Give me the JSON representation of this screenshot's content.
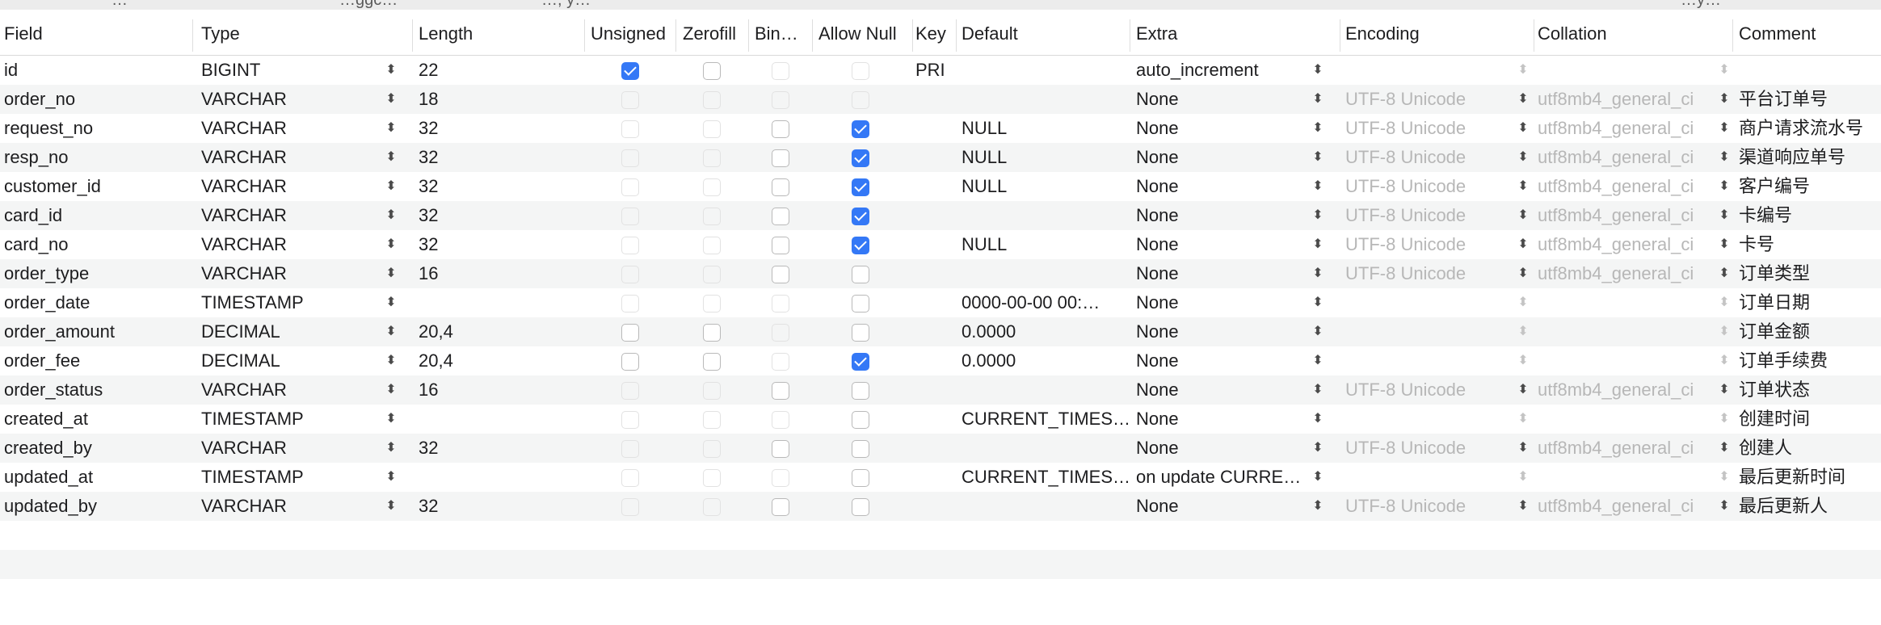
{
  "window_fragment": [
    "…",
    "…ggc…",
    "…, y…",
    "…y…"
  ],
  "columns": {
    "field": "Field",
    "type": "Type",
    "length": "Length",
    "unsigned": "Unsigned",
    "zerofill": "Zerofill",
    "binary": "Bin…",
    "allow_null": "Allow Null",
    "key": "Key",
    "default": "Default",
    "extra": "Extra",
    "encoding": "Encoding",
    "collation": "Collation",
    "comment": "Comment"
  },
  "rows": [
    {
      "field": "id",
      "type": "BIGINT",
      "length": "22",
      "unsigned": true,
      "zerofill": false,
      "binary": false,
      "allow_null": false,
      "key": "PRI",
      "default": "",
      "extra": "auto_increment",
      "encoding": "",
      "collation": "",
      "comment": "",
      "enabled": {
        "unsigned": true,
        "zerofill": true,
        "binary": false,
        "allow_null": false
      },
      "charset_enabled": false
    },
    {
      "field": "order_no",
      "type": "VARCHAR",
      "length": "18",
      "unsigned": false,
      "zerofill": false,
      "binary": false,
      "allow_null": false,
      "key": "",
      "default": "",
      "extra": "None",
      "encoding": "UTF-8 Unicode",
      "collation": "utf8mb4_general_ci",
      "comment": "平台订单号",
      "enabled": {
        "unsigned": false,
        "zerofill": false,
        "binary": false,
        "allow_null": false
      },
      "charset_enabled": true
    },
    {
      "field": "request_no",
      "type": "VARCHAR",
      "length": "32",
      "unsigned": false,
      "zerofill": false,
      "binary": false,
      "allow_null": true,
      "key": "",
      "default": "NULL",
      "extra": "None",
      "encoding": "UTF-8 Unicode",
      "collation": "utf8mb4_general_ci",
      "comment": "商户请求流水号",
      "enabled": {
        "unsigned": false,
        "zerofill": false,
        "binary": true,
        "allow_null": true
      },
      "charset_enabled": true
    },
    {
      "field": "resp_no",
      "type": "VARCHAR",
      "length": "32",
      "unsigned": false,
      "zerofill": false,
      "binary": false,
      "allow_null": true,
      "key": "",
      "default": "NULL",
      "extra": "None",
      "encoding": "UTF-8 Unicode",
      "collation": "utf8mb4_general_ci",
      "comment": "渠道响应单号",
      "enabled": {
        "unsigned": false,
        "zerofill": false,
        "binary": true,
        "allow_null": true
      },
      "charset_enabled": true
    },
    {
      "field": "customer_id",
      "type": "VARCHAR",
      "length": "32",
      "unsigned": false,
      "zerofill": false,
      "binary": false,
      "allow_null": true,
      "key": "",
      "default": "NULL",
      "extra": "None",
      "encoding": "UTF-8 Unicode",
      "collation": "utf8mb4_general_ci",
      "comment": "客户编号",
      "enabled": {
        "unsigned": false,
        "zerofill": false,
        "binary": true,
        "allow_null": true
      },
      "charset_enabled": true
    },
    {
      "field": "card_id",
      "type": "VARCHAR",
      "length": "32",
      "unsigned": false,
      "zerofill": false,
      "binary": false,
      "allow_null": true,
      "key": "",
      "default": "",
      "extra": "None",
      "encoding": "UTF-8 Unicode",
      "collation": "utf8mb4_general_ci",
      "comment": "卡编号",
      "enabled": {
        "unsigned": false,
        "zerofill": false,
        "binary": true,
        "allow_null": true
      },
      "charset_enabled": true
    },
    {
      "field": "card_no",
      "type": "VARCHAR",
      "length": "32",
      "unsigned": false,
      "zerofill": false,
      "binary": false,
      "allow_null": true,
      "key": "",
      "default": "NULL",
      "extra": "None",
      "encoding": "UTF-8 Unicode",
      "collation": "utf8mb4_general_ci",
      "comment": "卡号",
      "enabled": {
        "unsigned": false,
        "zerofill": false,
        "binary": true,
        "allow_null": true
      },
      "charset_enabled": true
    },
    {
      "field": "order_type",
      "type": "VARCHAR",
      "length": "16",
      "unsigned": false,
      "zerofill": false,
      "binary": false,
      "allow_null": false,
      "key": "",
      "default": "",
      "extra": "None",
      "encoding": "UTF-8 Unicode",
      "collation": "utf8mb4_general_ci",
      "comment": "订单类型",
      "enabled": {
        "unsigned": false,
        "zerofill": false,
        "binary": true,
        "allow_null": true
      },
      "charset_enabled": true
    },
    {
      "field": "order_date",
      "type": "TIMESTAMP",
      "length": "",
      "unsigned": false,
      "zerofill": false,
      "binary": false,
      "allow_null": false,
      "key": "",
      "default": "0000-00-00 00:…",
      "extra": "None",
      "encoding": "",
      "collation": "",
      "comment": "订单日期",
      "enabled": {
        "unsigned": false,
        "zerofill": false,
        "binary": false,
        "allow_null": true
      },
      "charset_enabled": false
    },
    {
      "field": "order_amount",
      "type": "DECIMAL",
      "length": "20,4",
      "unsigned": false,
      "zerofill": false,
      "binary": false,
      "allow_null": false,
      "key": "",
      "default": "0.0000",
      "extra": "None",
      "encoding": "",
      "collation": "",
      "comment": "订单金额",
      "enabled": {
        "unsigned": true,
        "zerofill": true,
        "binary": false,
        "allow_null": true
      },
      "charset_enabled": false
    },
    {
      "field": "order_fee",
      "type": "DECIMAL",
      "length": "20,4",
      "unsigned": false,
      "zerofill": false,
      "binary": false,
      "allow_null": true,
      "key": "",
      "default": "0.0000",
      "extra": "None",
      "encoding": "",
      "collation": "",
      "comment": "订单手续费",
      "enabled": {
        "unsigned": true,
        "zerofill": true,
        "binary": false,
        "allow_null": true
      },
      "charset_enabled": false
    },
    {
      "field": "order_status",
      "type": "VARCHAR",
      "length": "16",
      "unsigned": false,
      "zerofill": false,
      "binary": false,
      "allow_null": false,
      "key": "",
      "default": "",
      "extra": "None",
      "encoding": "UTF-8 Unicode",
      "collation": "utf8mb4_general_ci",
      "comment": "订单状态",
      "enabled": {
        "unsigned": false,
        "zerofill": false,
        "binary": true,
        "allow_null": true
      },
      "charset_enabled": true
    },
    {
      "field": "created_at",
      "type": "TIMESTAMP",
      "length": "",
      "unsigned": false,
      "zerofill": false,
      "binary": false,
      "allow_null": false,
      "key": "",
      "default": "CURRENT_TIMES…",
      "extra": "None",
      "encoding": "",
      "collation": "",
      "comment": "创建时间",
      "enabled": {
        "unsigned": false,
        "zerofill": false,
        "binary": false,
        "allow_null": true
      },
      "charset_enabled": false
    },
    {
      "field": "created_by",
      "type": "VARCHAR",
      "length": "32",
      "unsigned": false,
      "zerofill": false,
      "binary": false,
      "allow_null": false,
      "key": "",
      "default": "",
      "extra": "None",
      "encoding": "UTF-8 Unicode",
      "collation": "utf8mb4_general_ci",
      "comment": "创建人",
      "enabled": {
        "unsigned": false,
        "zerofill": false,
        "binary": true,
        "allow_null": true
      },
      "charset_enabled": true
    },
    {
      "field": "updated_at",
      "type": "TIMESTAMP",
      "length": "",
      "unsigned": false,
      "zerofill": false,
      "binary": false,
      "allow_null": false,
      "key": "",
      "default": "CURRENT_TIMES…",
      "extra": "on update CURRE…",
      "encoding": "",
      "collation": "",
      "comment": "最后更新时间",
      "enabled": {
        "unsigned": false,
        "zerofill": false,
        "binary": false,
        "allow_null": true
      },
      "charset_enabled": false
    },
    {
      "field": "updated_by",
      "type": "VARCHAR",
      "length": "32",
      "unsigned": false,
      "zerofill": false,
      "binary": false,
      "allow_null": false,
      "key": "",
      "default": "",
      "extra": "None",
      "encoding": "UTF-8 Unicode",
      "collation": "utf8mb4_general_ci",
      "comment": "最后更新人",
      "enabled": {
        "unsigned": false,
        "zerofill": false,
        "binary": true,
        "allow_null": true
      },
      "charset_enabled": true
    }
  ],
  "colors": {
    "accent": "#3478f6",
    "row_alt": "#f4f5f5",
    "disabled_text": "#b7b7b7"
  }
}
